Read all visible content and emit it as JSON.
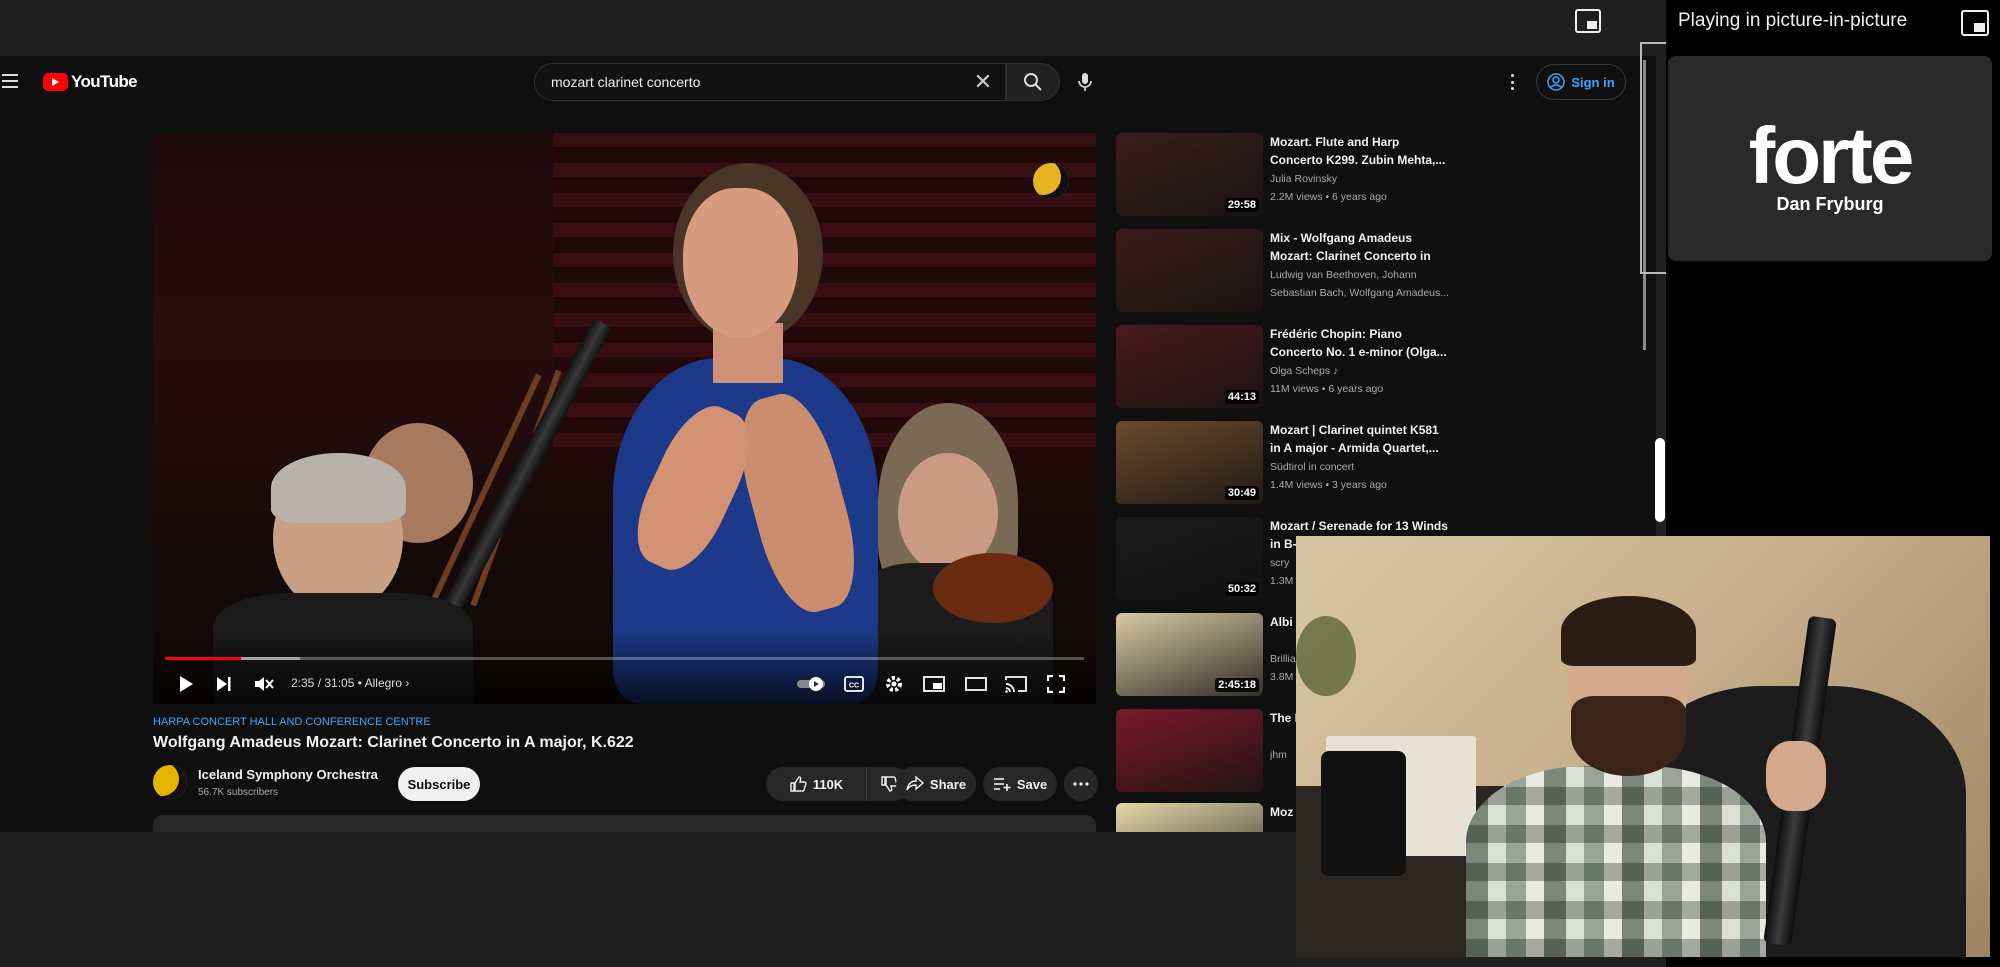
{
  "browser": {
    "pip_status_label": "Playing in picture-in-picture"
  },
  "youtube": {
    "logo_text": "YouTube",
    "search": {
      "value": "mozart clarinet concerto",
      "clear_glyph": "✕"
    },
    "sign_in_label": "Sign in",
    "player": {
      "progress_fraction": 0.083,
      "buffer_fraction": 0.147,
      "time_current": "2:35",
      "time_total": "31:05",
      "chapter": "Allegro"
    },
    "video": {
      "channel_link": "HARPA CONCERT HALL AND CONFERENCE CENTRE",
      "title": "Wolfgang Amadeus Mozart: Clarinet Concerto in A major, K.622",
      "channel_name": "Iceland Symphony Orchestra",
      "subscribers": "56.7K subscribers",
      "subscribe_label": "Subscribe",
      "like_count": "110K",
      "share_label": "Share",
      "save_label": "Save"
    },
    "recommendations": [
      {
        "title": "Mozart. Flute and Harp Concerto K299. Zubin Mehta,...",
        "channel": "Julia Rovinsky",
        "stats": "2.2M views • 6 years ago",
        "duration": "29:58",
        "thumb_color": "#3a1f1c"
      },
      {
        "title": "Mix - Wolfgang Amadeus Mozart: Clarinet Concerto in A...",
        "channel": "Ludwig van Beethoven, Johann",
        "stats": "Sebastian Bach, Wolfgang Amadeus...",
        "duration": "",
        "thumb_color": "#3b1d18"
      },
      {
        "title": "Frédéric Chopin: Piano Concerto No. 1 e-minor (Olga...",
        "channel": "Olga Scheps ♪",
        "stats": "11M views • 6 years ago",
        "duration": "44:13",
        "thumb_color": "#4a1a1e"
      },
      {
        "title": "Mozart | Clarinet quintet K581 in A major - Armida Quartet,...",
        "channel": "Südtirol in concert",
        "stats": "1.4M views • 3 years ago",
        "duration": "30:49",
        "thumb_color": "#6b4a2c"
      },
      {
        "title": "Mozart / Serenade for 13 Winds in B-",
        "channel": "scry",
        "stats": "1.3M",
        "duration": "50:32",
        "thumb_color": "#1a1a1a"
      },
      {
        "title": "Albi Conc",
        "channel": "Brillia",
        "stats": "3.8M",
        "duration": "2:45:18",
        "thumb_color": "#d8c9a2"
      },
      {
        "title": "The Movi",
        "channel": "jhm",
        "stats": "",
        "duration": "",
        "thumb_color": "#7a1a2a"
      },
      {
        "title": "Moz No 1",
        "channel": "",
        "stats": "",
        "duration": "",
        "thumb_color": "#e6d8a8"
      }
    ]
  },
  "pip": {
    "logo_text": "forte",
    "presenter": "Dan Fryburg"
  },
  "colors": {
    "accent_red": "#ff0000",
    "link_blue": "#3ea6ff",
    "background": "#0f0f0f"
  }
}
